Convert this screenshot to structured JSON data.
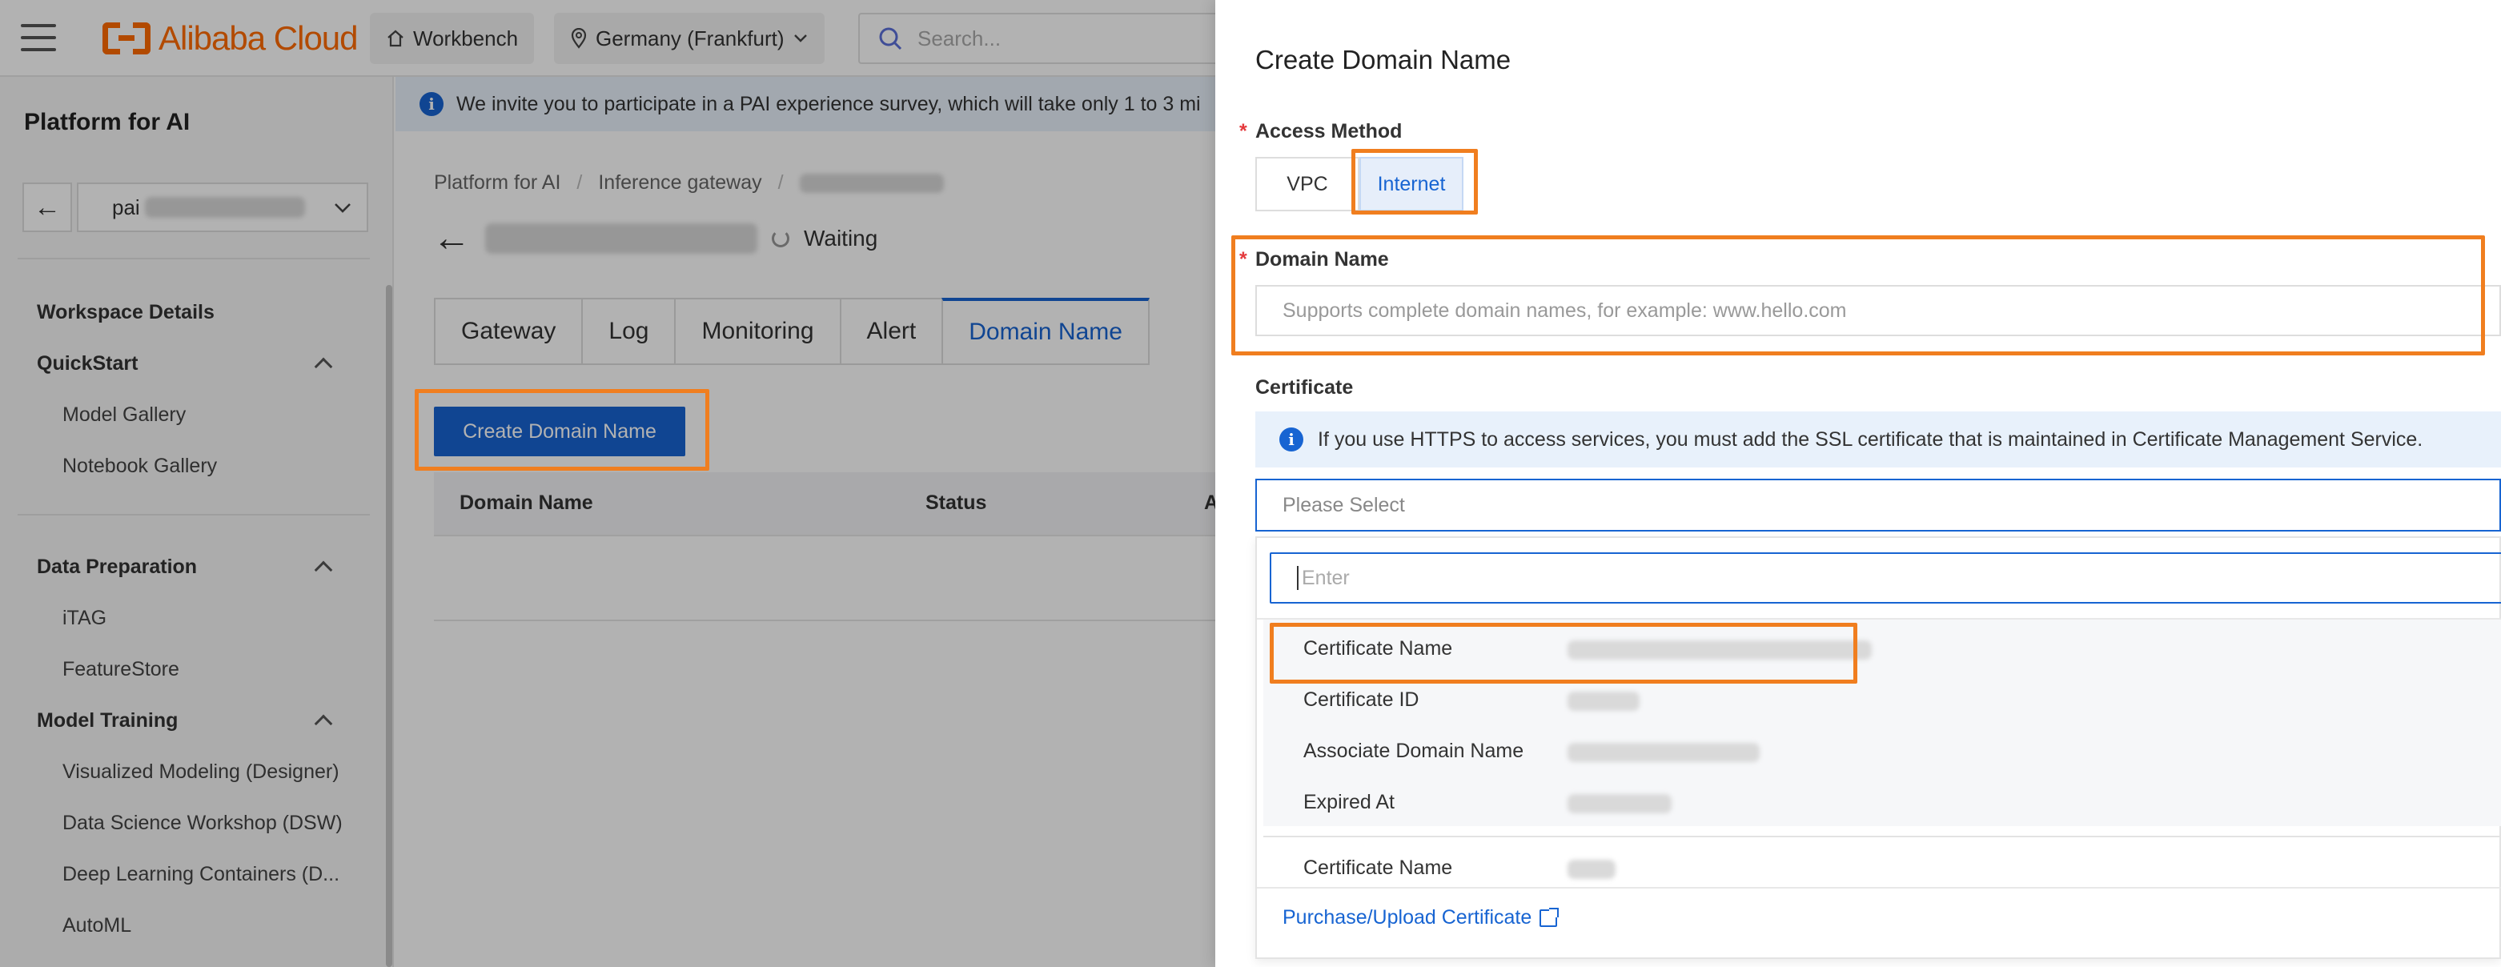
{
  "topbar": {
    "logo_text": "Alibaba Cloud",
    "workbench": "Workbench",
    "region": "Germany (Frankfurt)",
    "search_placeholder": "Search..."
  },
  "sidebar": {
    "title": "Platform for AI",
    "workspace_prefix": "pai",
    "sections": [
      {
        "label": "Workspace Details"
      },
      {
        "label": "QuickStart",
        "items": [
          "Model Gallery",
          "Notebook Gallery"
        ]
      },
      {
        "label": "Data Preparation",
        "items": [
          "iTAG",
          "FeatureStore"
        ]
      },
      {
        "label": "Model Training",
        "items": [
          "Visualized Modeling (Designer)",
          "Data Science Workshop (DSW)",
          "Deep Learning Containers (D...",
          "AutoML"
        ]
      }
    ]
  },
  "main": {
    "banner": "We invite you to participate in a PAI experience survey, which will take only 1 to 3 mi",
    "breadcrumb": [
      "Platform for AI",
      "Inference gateway"
    ],
    "status": "Waiting",
    "tabs": [
      "Gateway",
      "Log",
      "Monitoring",
      "Alert",
      "Domain Name"
    ],
    "active_tab": "Domain Name",
    "create_button": "Create Domain Name",
    "table_columns": [
      "Domain Name",
      "Status",
      "A"
    ]
  },
  "drawer": {
    "title": "Create Domain Name",
    "access_method": {
      "label": "Access Method",
      "options": [
        "VPC",
        "Internet"
      ],
      "selected": "Internet"
    },
    "domain_name": {
      "label": "Domain Name",
      "placeholder": "Supports complete domain names, for example: www.hello.com"
    },
    "certificate": {
      "label": "Certificate",
      "info": "If you use HTTPS to access services, you must add the SSL certificate that is maintained in Certificate Management Service.",
      "select_placeholder": "Please Select",
      "search_placeholder": "Enter",
      "option_fields": [
        "Certificate Name",
        "Certificate ID",
        "Associate Domain Name",
        "Expired At"
      ],
      "second_option_field": "Certificate Name",
      "purchase_link": "Purchase/Upload Certificate"
    }
  },
  "colors": {
    "brand": "#ff6a00",
    "primary": "#1764d2",
    "highlight": "#f07e1f",
    "required": "#e4393c"
  }
}
